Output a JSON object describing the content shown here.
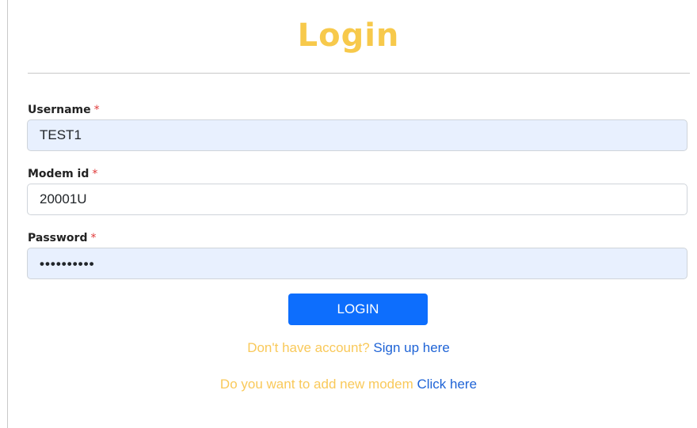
{
  "page": {
    "title": "Login"
  },
  "form": {
    "username": {
      "label": "Username",
      "required_mark": "*",
      "value": "TEST1"
    },
    "modem_id": {
      "label": "Modem id",
      "required_mark": "*",
      "value": "20001U"
    },
    "password": {
      "label": "Password",
      "required_mark": "*",
      "masked_value": "••••••••••"
    },
    "submit_label": "LOGIN"
  },
  "links": {
    "signup_prompt": "Don't have account?",
    "signup_link": "Sign up here",
    "modem_prompt": "Do you want to add new modem",
    "modem_link": "Click here"
  },
  "colors": {
    "title": "#f7c94b",
    "required": "#e03a3a",
    "button": "#0d6efd",
    "link": "#1e63d6",
    "muted_text": "#f9c95a",
    "autofill_bg": "#e8f0fe"
  }
}
